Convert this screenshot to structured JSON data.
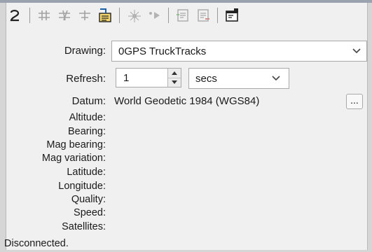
{
  "toolbar": {
    "buttons": [
      {
        "icon": "connect-icon",
        "enabled": true
      },
      {
        "icon": "track-add-icon",
        "enabled": false
      },
      {
        "icon": "track-up-icon",
        "enabled": false
      },
      {
        "icon": "track-down-icon",
        "enabled": false
      },
      {
        "icon": "drawing-select-icon",
        "enabled": true
      },
      {
        "icon": "signal-icon",
        "enabled": false
      },
      {
        "icon": "play-icon",
        "enabled": false
      },
      {
        "icon": "log-start-icon",
        "enabled": false
      },
      {
        "icon": "log-stop-icon",
        "enabled": false
      },
      {
        "icon": "properties-icon",
        "enabled": true
      }
    ]
  },
  "form": {
    "drawing_label": "Drawing:",
    "drawing_value": "0GPS TruckTracks",
    "refresh_label": "Refresh:",
    "refresh_value": "1",
    "refresh_unit": "secs",
    "datum_label": "Datum:",
    "datum_value": "World Geodetic 1984 (WGS84)",
    "datum_button_label": "..."
  },
  "fields": [
    "Altitude:",
    "Bearing:",
    "Mag bearing:",
    "Mag variation:",
    "Latitude:",
    "Longitude:",
    "Quality:",
    "Speed:",
    "Satellites:"
  ],
  "status": "Disconnected."
}
